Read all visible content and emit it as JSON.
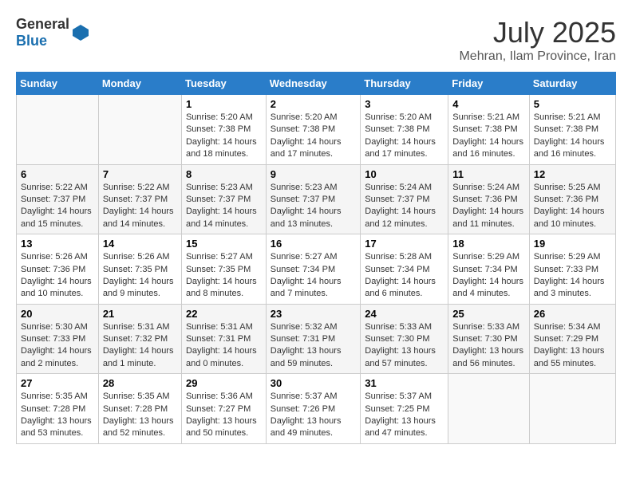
{
  "header": {
    "logo_general": "General",
    "logo_blue": "Blue",
    "month": "July 2025",
    "location": "Mehran, Ilam Province, Iran"
  },
  "days_of_week": [
    "Sunday",
    "Monday",
    "Tuesday",
    "Wednesday",
    "Thursday",
    "Friday",
    "Saturday"
  ],
  "weeks": [
    [
      {
        "day": "",
        "info": ""
      },
      {
        "day": "",
        "info": ""
      },
      {
        "day": "1",
        "sunrise": "5:20 AM",
        "sunset": "7:38 PM",
        "daylight": "14 hours and 18 minutes."
      },
      {
        "day": "2",
        "sunrise": "5:20 AM",
        "sunset": "7:38 PM",
        "daylight": "14 hours and 17 minutes."
      },
      {
        "day": "3",
        "sunrise": "5:20 AM",
        "sunset": "7:38 PM",
        "daylight": "14 hours and 17 minutes."
      },
      {
        "day": "4",
        "sunrise": "5:21 AM",
        "sunset": "7:38 PM",
        "daylight": "14 hours and 16 minutes."
      },
      {
        "day": "5",
        "sunrise": "5:21 AM",
        "sunset": "7:38 PM",
        "daylight": "14 hours and 16 minutes."
      }
    ],
    [
      {
        "day": "6",
        "sunrise": "5:22 AM",
        "sunset": "7:37 PM",
        "daylight": "14 hours and 15 minutes."
      },
      {
        "day": "7",
        "sunrise": "5:22 AM",
        "sunset": "7:37 PM",
        "daylight": "14 hours and 14 minutes."
      },
      {
        "day": "8",
        "sunrise": "5:23 AM",
        "sunset": "7:37 PM",
        "daylight": "14 hours and 14 minutes."
      },
      {
        "day": "9",
        "sunrise": "5:23 AM",
        "sunset": "7:37 PM",
        "daylight": "14 hours and 13 minutes."
      },
      {
        "day": "10",
        "sunrise": "5:24 AM",
        "sunset": "7:37 PM",
        "daylight": "14 hours and 12 minutes."
      },
      {
        "day": "11",
        "sunrise": "5:24 AM",
        "sunset": "7:36 PM",
        "daylight": "14 hours and 11 minutes."
      },
      {
        "day": "12",
        "sunrise": "5:25 AM",
        "sunset": "7:36 PM",
        "daylight": "14 hours and 10 minutes."
      }
    ],
    [
      {
        "day": "13",
        "sunrise": "5:26 AM",
        "sunset": "7:36 PM",
        "daylight": "14 hours and 10 minutes."
      },
      {
        "day": "14",
        "sunrise": "5:26 AM",
        "sunset": "7:35 PM",
        "daylight": "14 hours and 9 minutes."
      },
      {
        "day": "15",
        "sunrise": "5:27 AM",
        "sunset": "7:35 PM",
        "daylight": "14 hours and 8 minutes."
      },
      {
        "day": "16",
        "sunrise": "5:27 AM",
        "sunset": "7:34 PM",
        "daylight": "14 hours and 7 minutes."
      },
      {
        "day": "17",
        "sunrise": "5:28 AM",
        "sunset": "7:34 PM",
        "daylight": "14 hours and 6 minutes."
      },
      {
        "day": "18",
        "sunrise": "5:29 AM",
        "sunset": "7:34 PM",
        "daylight": "14 hours and 4 minutes."
      },
      {
        "day": "19",
        "sunrise": "5:29 AM",
        "sunset": "7:33 PM",
        "daylight": "14 hours and 3 minutes."
      }
    ],
    [
      {
        "day": "20",
        "sunrise": "5:30 AM",
        "sunset": "7:33 PM",
        "daylight": "14 hours and 2 minutes."
      },
      {
        "day": "21",
        "sunrise": "5:31 AM",
        "sunset": "7:32 PM",
        "daylight": "14 hours and 1 minute."
      },
      {
        "day": "22",
        "sunrise": "5:31 AM",
        "sunset": "7:31 PM",
        "daylight": "14 hours and 0 minutes."
      },
      {
        "day": "23",
        "sunrise": "5:32 AM",
        "sunset": "7:31 PM",
        "daylight": "13 hours and 59 minutes."
      },
      {
        "day": "24",
        "sunrise": "5:33 AM",
        "sunset": "7:30 PM",
        "daylight": "13 hours and 57 minutes."
      },
      {
        "day": "25",
        "sunrise": "5:33 AM",
        "sunset": "7:30 PM",
        "daylight": "13 hours and 56 minutes."
      },
      {
        "day": "26",
        "sunrise": "5:34 AM",
        "sunset": "7:29 PM",
        "daylight": "13 hours and 55 minutes."
      }
    ],
    [
      {
        "day": "27",
        "sunrise": "5:35 AM",
        "sunset": "7:28 PM",
        "daylight": "13 hours and 53 minutes."
      },
      {
        "day": "28",
        "sunrise": "5:35 AM",
        "sunset": "7:28 PM",
        "daylight": "13 hours and 52 minutes."
      },
      {
        "day": "29",
        "sunrise": "5:36 AM",
        "sunset": "7:27 PM",
        "daylight": "13 hours and 50 minutes."
      },
      {
        "day": "30",
        "sunrise": "5:37 AM",
        "sunset": "7:26 PM",
        "daylight": "13 hours and 49 minutes."
      },
      {
        "day": "31",
        "sunrise": "5:37 AM",
        "sunset": "7:25 PM",
        "daylight": "13 hours and 47 minutes."
      },
      {
        "day": "",
        "info": ""
      },
      {
        "day": "",
        "info": ""
      }
    ]
  ],
  "labels": {
    "sunrise": "Sunrise:",
    "sunset": "Sunset:",
    "daylight": "Daylight:"
  }
}
